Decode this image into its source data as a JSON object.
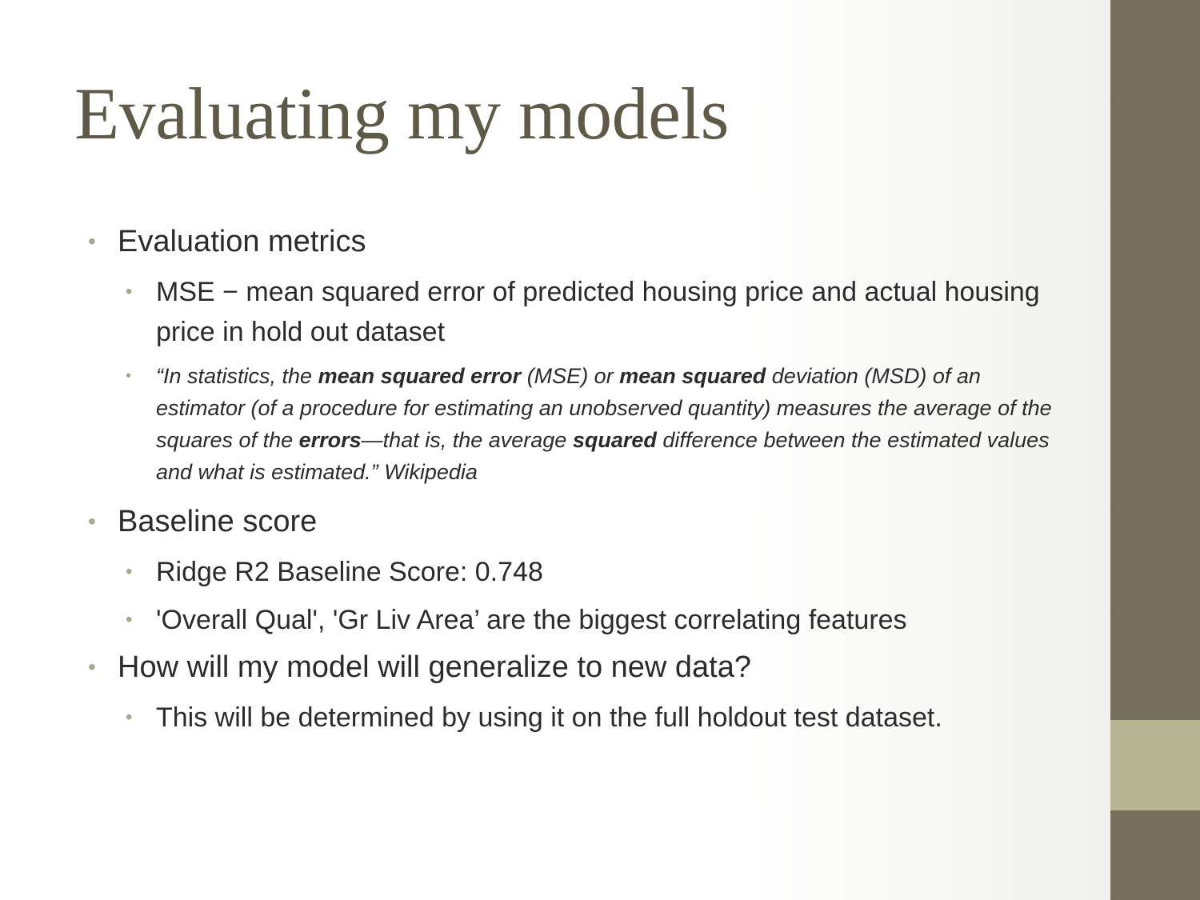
{
  "slide": {
    "title": "Evaluating my models",
    "bullet_glyph": "•",
    "sections": {
      "metrics": {
        "heading": "Evaluation metrics",
        "mse": "MSE − mean squared error of predicted housing price and actual housing price in hold out dataset",
        "quote": {
          "p1": "“In statistics, the ",
          "b1": "mean squared error",
          "p2": " (MSE) or ",
          "b2": "mean squared",
          "p3": " deviation (MSD) of an estimator (of a procedure for estimating an unobserved quantity) measures the average of the squares of the ",
          "b3": "errors",
          "p4": "—that is, the average ",
          "b4": "squared",
          "p5": " difference between the estimated values and what is estimated.” Wikipedia"
        }
      },
      "baseline": {
        "heading": "Baseline score",
        "score": "Ridge R2 Baseline Score: 0.748",
        "features": "'Overall Qual', 'Gr Liv Area’ are the biggest correlating features"
      },
      "generalize": {
        "heading": "How will my model will generalize to new data?",
        "answer": "This will be determined by using it on the full holdout test dataset."
      }
    },
    "colors": {
      "title": "#5e5a47",
      "sidebar": "#76705c",
      "sidebar_accent": "#b7b493",
      "bullet": "#a9a68c"
    }
  }
}
